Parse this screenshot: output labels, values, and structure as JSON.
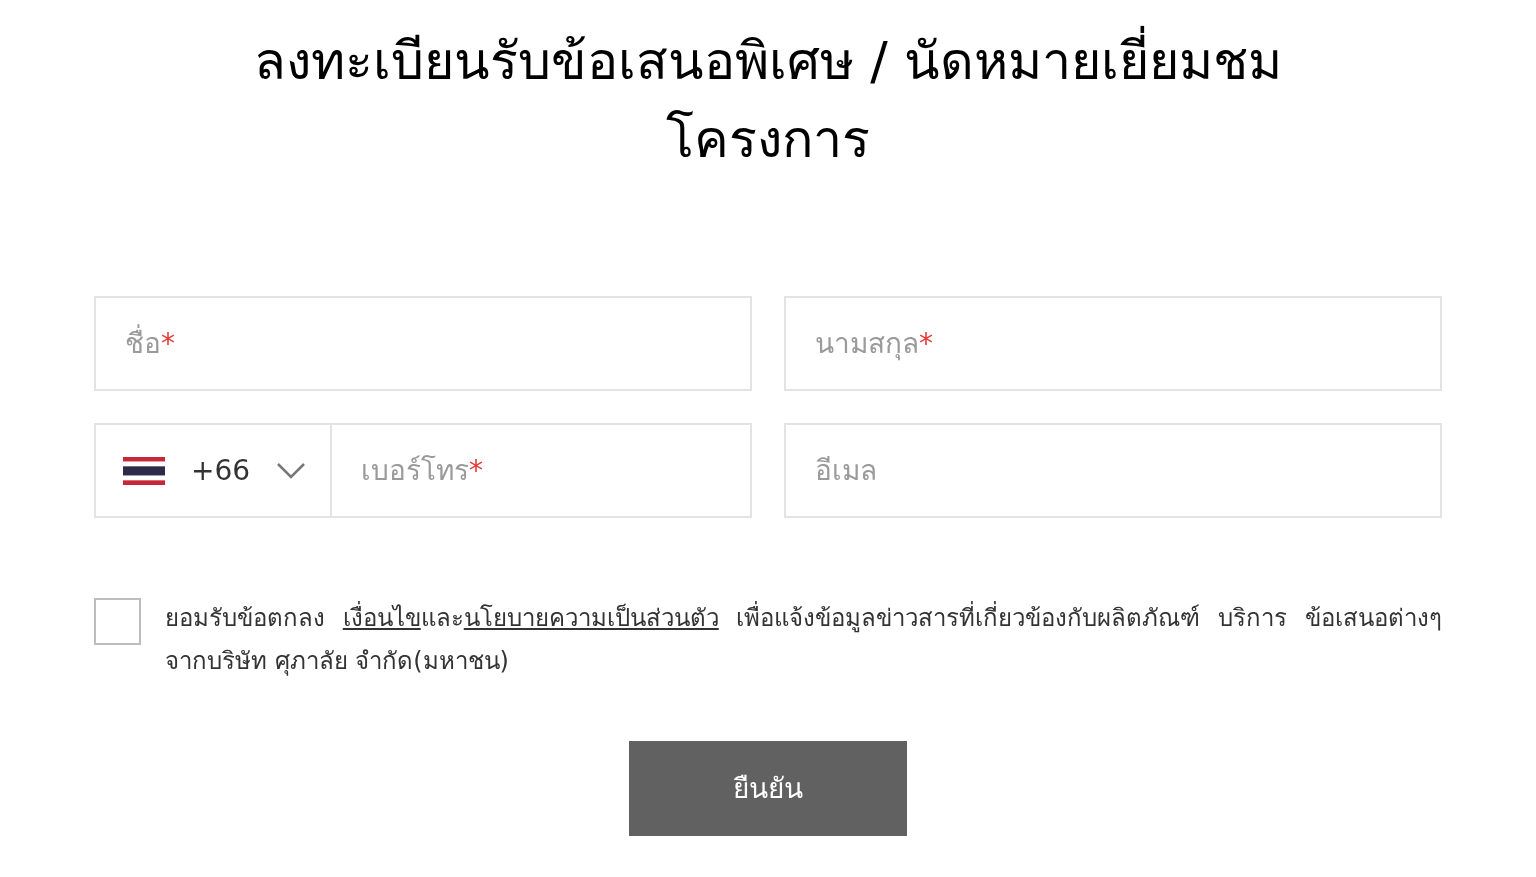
{
  "title": "ลงทะเบียนรับข้อเสนอพิเศษ / นัดหมายเยี่ยมชมโครงการ",
  "first_name": {
    "placeholder": "ชื่อ",
    "required_mark": "*"
  },
  "last_name": {
    "placeholder": "นามสกุล",
    "required_mark": "*"
  },
  "phone": {
    "country_code": "+66",
    "placeholder": "เบอร์โทร",
    "required_mark": "*"
  },
  "email": {
    "placeholder": "อีเมล"
  },
  "consent": {
    "checked": false,
    "parts": [
      {
        "kind": "text",
        "text": "ยอมรับข้อตกลง "
      },
      {
        "kind": "link",
        "text": "เงื่อนไข"
      },
      {
        "kind": "text",
        "text": "และ"
      },
      {
        "kind": "link",
        "text": "นโยบายความเป็นส่วนตัว"
      },
      {
        "kind": "text",
        "text": " เพื่อแจ้งข้อมูลข่าวสารที่เกี่ยวข้องกับผลิตภัณฑ์ บริการ ข้อเสนอต่างๆ จากบริษัท ศุภาลัย จำกัด(มหาชน)"
      }
    ]
  },
  "submit": {
    "label": "ยืนยัน"
  }
}
